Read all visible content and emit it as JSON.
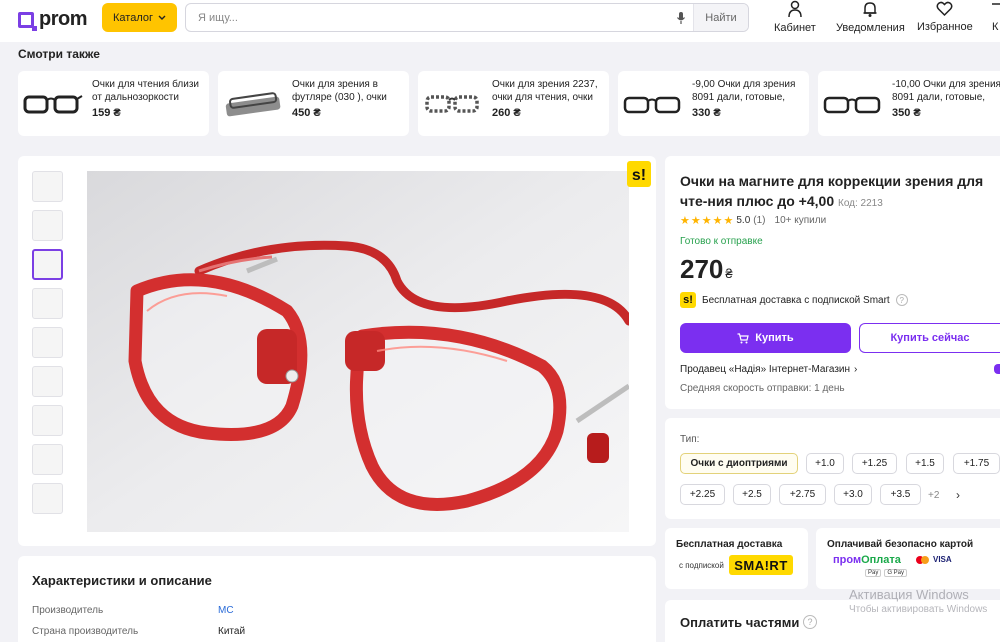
{
  "header": {
    "logo_text": "prom",
    "catalog_label": "Каталог",
    "search_placeholder": "Я ищу...",
    "search_button": "Найти",
    "links": [
      "Кабинет",
      "Уведомления",
      "Избранное",
      "К"
    ]
  },
  "see_also": {
    "title": "Смотри также",
    "items": [
      {
        "title": "Очки для чтения близи от дальнозоркости",
        "price": "159 ₴"
      },
      {
        "title": "Очки для зрения в футляре (030 ), очки",
        "price": "450 ₴"
      },
      {
        "title": "Очки для зрения 2237, очки для чтения, очки",
        "price": "260 ₴"
      },
      {
        "title": "-9,00 Очки для зрения 8091 дали, готовые,",
        "price": "330 ₴"
      },
      {
        "title": "-10,00 Очки для зрения 8091 дали, готовые,",
        "price": "350 ₴"
      }
    ]
  },
  "product": {
    "title": "Очки на магните для коррекции зрения для чте-ния плюс до +4,00",
    "code": "Код: 2213",
    "rating": "5.0",
    "reviews": "(1)",
    "purchases": "10+ купили",
    "stock": "Готово к отправке",
    "price": "270",
    "currency": "₴",
    "smart_badge": "s!",
    "delivery_text": "Бесплатная доставка с подпиской Smart",
    "buy_label": "Купить",
    "buy_now_label": "Купить сейчас",
    "seller": "Продавец «Надія» Інтернет-Магазин",
    "ship_speed": "Средняя скорость отправки: 1 день"
  },
  "options": {
    "label": "Тип:",
    "chips": [
      "Очки с диоптриями",
      "+1.0",
      "+1.25",
      "+1.5",
      "+1.75",
      "+2.25",
      "+2.5",
      "+2.75",
      "+3.0",
      "+3.5"
    ],
    "selected": "Очки с диоптриями",
    "more": "+2"
  },
  "cards": {
    "free_delivery_title": "Бесплатная доставка",
    "free_delivery_sub": "с подпиской",
    "smart_logo": "SMA!RT",
    "pay_title": "Оплачивай безопасно картой",
    "prom_pay_a": "пром",
    "prom_pay_b": "Оплата",
    "visa": "VISA",
    "wallets": [
      "Pay",
      "G Pay"
    ]
  },
  "installments": {
    "title": "Оплатить частями"
  },
  "characteristics": {
    "title": "Характеристики и описание",
    "rows": [
      {
        "name": "Производитель",
        "value": "MC"
      },
      {
        "name": "Страна производитель",
        "value": "Китай"
      }
    ]
  },
  "watermark": {
    "line1": "Активация Windows",
    "line2": "Чтобы активировать Windows"
  },
  "colors": {
    "accent": "#7b2ff0",
    "yellow": "#ffc400",
    "success": "#27a14d",
    "frame_red": "#d32f2f"
  }
}
